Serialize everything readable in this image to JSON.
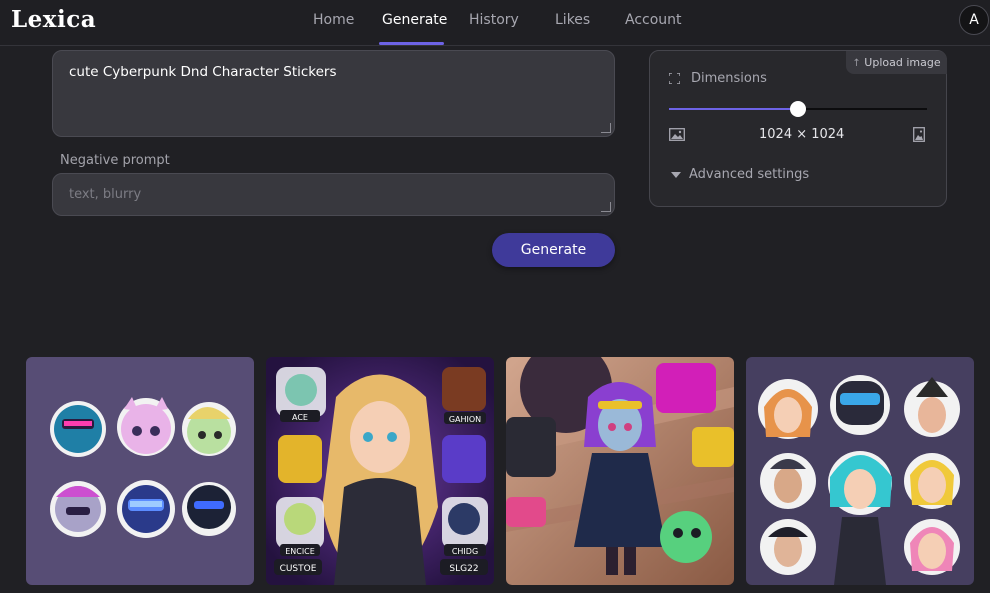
{
  "app": {
    "logo": "Lexica"
  },
  "nav": {
    "items": [
      {
        "label": "Home",
        "active": false
      },
      {
        "label": "Generate",
        "active": true
      },
      {
        "label": "History",
        "active": false
      },
      {
        "label": "Likes",
        "active": false
      },
      {
        "label": "Account",
        "active": false
      }
    ],
    "avatar_initial": "A"
  },
  "prompt": {
    "value": "cute Cyberpunk Dnd Character Stickers"
  },
  "negative_prompt": {
    "label": "Negative prompt",
    "placeholder": "text, blurry",
    "value": ""
  },
  "generate_button": {
    "label": "Generate"
  },
  "settings": {
    "upload_label": "Upload image",
    "dimensions_label": "Dimensions",
    "dimensions_value": "1024 × 1024",
    "slider_level": 0.5,
    "advanced_label": "Advanced settings",
    "icons": [
      "expand-icon",
      "landscape-image-icon",
      "portrait-image-icon",
      "caret-down-icon"
    ]
  },
  "results": {
    "images": [
      {
        "name": "result-image-1",
        "bg": "#574d75"
      },
      {
        "name": "result-image-2",
        "bg": "#3a1f5e",
        "labels": [
          "ACE",
          "GAHION",
          "ENCICE",
          "CHIDG",
          "CUSTOE",
          "SLG22"
        ]
      },
      {
        "name": "result-image-3",
        "bg": "#b98a73"
      },
      {
        "name": "result-image-4",
        "bg": "#463f60"
      }
    ]
  },
  "colors": {
    "accent": "#6d63e6",
    "button": "#3f3a9a",
    "background": "#202024"
  }
}
